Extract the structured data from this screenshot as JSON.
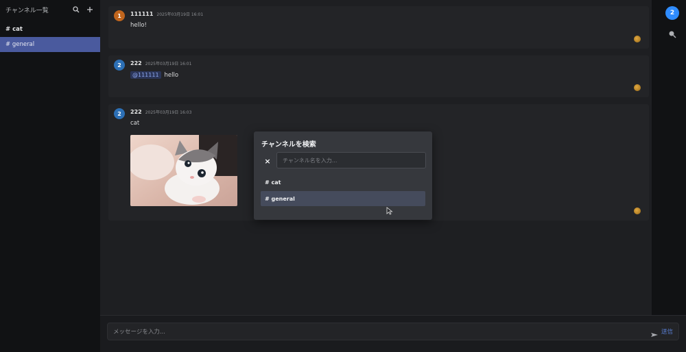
{
  "sidebar": {
    "title": "チャンネル一覧",
    "channels": [
      {
        "label": "# cat"
      },
      {
        "label": "# general"
      }
    ]
  },
  "messages": [
    {
      "avatar": "1",
      "user": "111111",
      "time": "2025年03月19日 16:01",
      "text": "hello!"
    },
    {
      "avatar": "2",
      "user": "222",
      "time": "2025年03月19日 16:01",
      "mention": "@111111",
      "text": "hello"
    },
    {
      "avatar": "2",
      "user": "222",
      "time": "2025年03月19日 16:03",
      "text": "cat"
    }
  ],
  "rail": {
    "badge": "2"
  },
  "composer": {
    "placeholder": "メッセージを入力...",
    "send_label": "送信"
  },
  "modal": {
    "title": "チャンネルを検索",
    "close": "×",
    "search_placeholder": "チャンネル名を入力...",
    "results": [
      {
        "label": "# cat"
      },
      {
        "label": "# general"
      }
    ]
  },
  "colors": {
    "accent": "#4a5a9e",
    "badge": "#2f8cff",
    "avatar_orange": "#c0651d",
    "avatar_blue": "#2c6fb5"
  }
}
